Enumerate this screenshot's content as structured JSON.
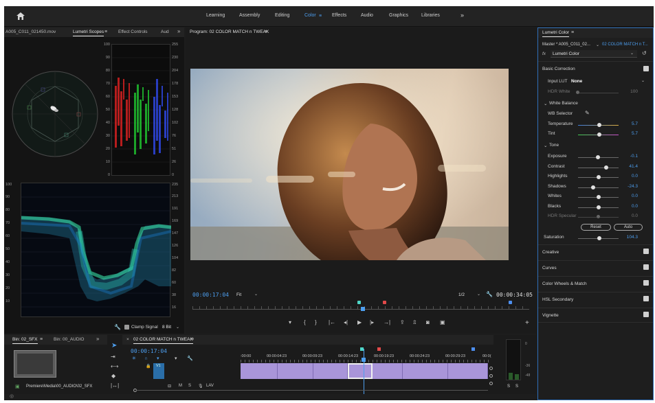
{
  "workspaces": {
    "items": [
      "Learning",
      "Assembly",
      "Editing",
      "Color",
      "Effects",
      "Audio",
      "Graphics",
      "Libraries"
    ],
    "active": "Color",
    "more": "»"
  },
  "scopes_panel": {
    "tab_source": "A005_C011_021450.mov",
    "tab_scopes": "Lumetri Scopes",
    "tab_effects": "Effect Controls",
    "tab_aud": "Aud",
    "more": "»",
    "parade_scale_left": [
      "100",
      "90",
      "80",
      "70",
      "60",
      "50",
      "40",
      "30",
      "20",
      "10",
      "0"
    ],
    "parade_scale_right": [
      "255",
      "230",
      "204",
      "178",
      "153",
      "128",
      "102",
      "76",
      "51",
      "26",
      "0"
    ],
    "waveform_scale_left": [
      "100",
      "90",
      "80",
      "70",
      "60",
      "50",
      "40",
      "30",
      "20",
      "10"
    ],
    "waveform_scale_right": [
      "235",
      "213",
      "191",
      "169",
      "147",
      "126",
      "104",
      "82",
      "60",
      "38",
      "16"
    ],
    "clamp_signal": "Clamp Signal",
    "bit_depth": "8 Bit"
  },
  "program": {
    "title": "Program: 02 COLOR MATCH n TWEAK",
    "timecode_current": "00:00:17:04",
    "fit": "Fit",
    "resolution": "1/2",
    "timecode_duration": "00:00:34:05"
  },
  "lumetri": {
    "title": "Lumetri Color",
    "master_clip": "Master * A005_C011_02...",
    "sequence_clip": "02 COLOR MATCH n T...",
    "fx_label": "fx",
    "effect_name": "Lumetri Color",
    "basic_correction": "Basic Correction",
    "input_lut_label": "Input LUT",
    "input_lut_value": "None",
    "hdr_white_label": "HDR White",
    "hdr_white_value": "100",
    "white_balance": "White Balance",
    "wb_selector": "WB Selector",
    "temperature_label": "Temperature",
    "temperature_value": "5.7",
    "tint_label": "Tint",
    "tint_value": "5.7",
    "tone": "Tone",
    "exposure_label": "Exposure",
    "exposure_value": "-0.1",
    "contrast_label": "Contrast",
    "contrast_value": "41.4",
    "highlights_label": "Highlights",
    "highlights_value": "0.0",
    "shadows_label": "Shadows",
    "shadows_value": "-24.3",
    "whites_label": "Whites",
    "whites_value": "0.0",
    "blacks_label": "Blacks",
    "blacks_value": "0.0",
    "hdr_specular_label": "HDR Specular",
    "hdr_specular_value": "0.0",
    "reset": "Reset",
    "auto": "Auto",
    "saturation_label": "Saturation",
    "saturation_value": "104.3",
    "sections": [
      "Creative",
      "Curves",
      "Color Wheels & Match",
      "HSL Secondary",
      "Vignette"
    ]
  },
  "project_panel": {
    "tab_bin_sfx": "Bin: 02_SFX",
    "tab_bin_audio": "Bin: 00_AUDIO",
    "more": "»",
    "path": "Premiere\\Media\\00_AUDIO\\02_SFX"
  },
  "timeline": {
    "title": "02 COLOR MATCH n TWEAK",
    "close": "×",
    "timecode": "00:00:17:04",
    "ruler": [
      ":00:00",
      "00:00:04:23",
      "00:00:09:23",
      "00:00:14:23",
      "00:00:19:23",
      "00:00:24:23",
      "00:00:29:23",
      "00:0("
    ],
    "track_v1": "V1",
    "track_m": "M",
    "track_s": "S",
    "track_lav": "LAV"
  },
  "audio_meter": {
    "scale": [
      "0",
      "-36",
      "-48"
    ],
    "solo_left": "S",
    "solo_right": "S"
  },
  "colors": {
    "accent": "#4d9ff0",
    "clip_purple": "#a995d9",
    "track_blue": "#2a6ea8"
  }
}
